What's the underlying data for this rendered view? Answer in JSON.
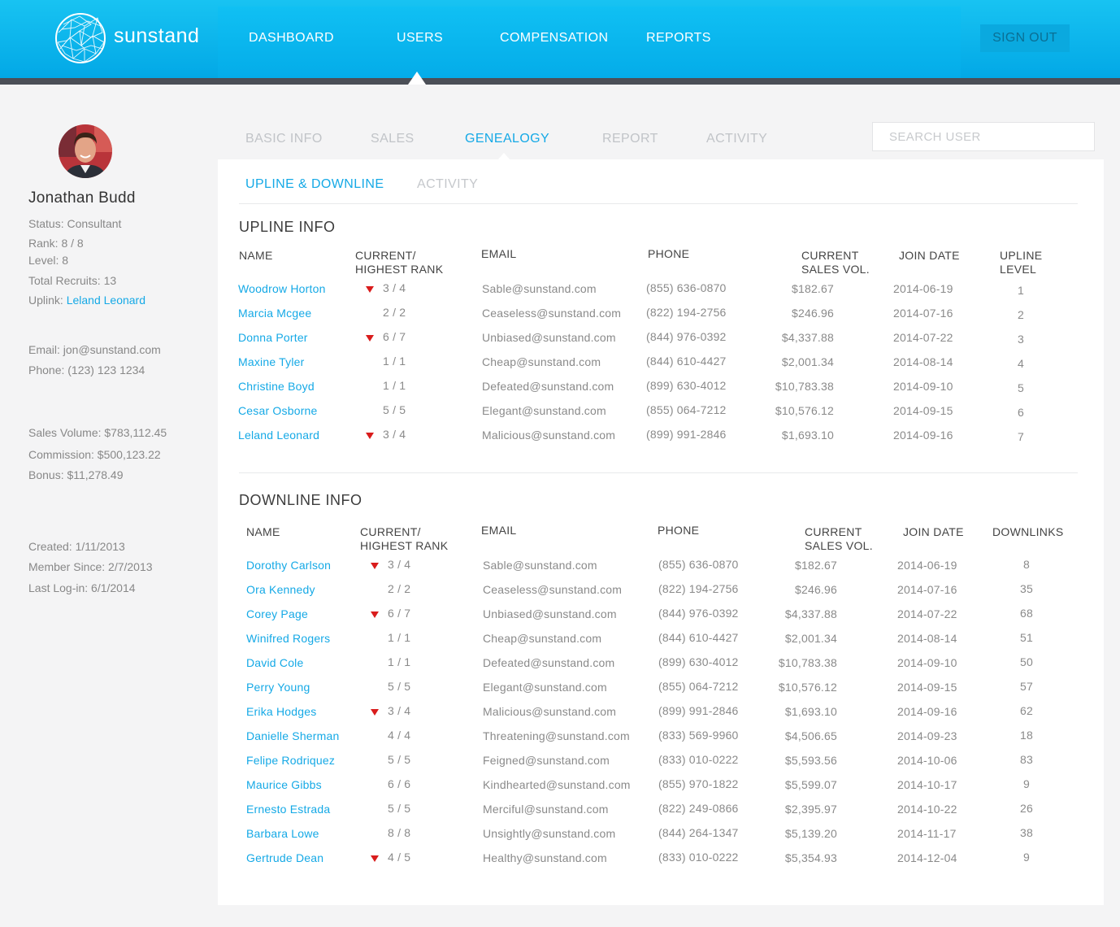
{
  "brand": {
    "name": "sunstand"
  },
  "nav": {
    "items": [
      "DASHBOARD",
      "USERS",
      "COMPENSATION",
      "REPORTS"
    ],
    "active": "USERS",
    "signout": "SIGN OUT"
  },
  "profile": {
    "name": "Jonathan Budd",
    "status_label": "Status: Consultant",
    "rank_label": "Rank: 8 / 8",
    "level_label": "Level: 8",
    "recruits_label": "Total Recruits: 13",
    "uplink_label": "Uplink: ",
    "uplink_name": "Leland Leonard",
    "email_label": "Email: jon@sunstand.com",
    "phone_label": "Phone: (123) 123 1234",
    "sales_label": "Sales Volume: $783,112.45",
    "commission_label": "Commission: $500,123.22",
    "bonus_label": "Bonus: $11,278.49",
    "created_label": "Created: 1/11/2013",
    "member_label": "Member Since: 2/7/2013",
    "login_label": "Last Log-in: 6/1/2014"
  },
  "tabs": {
    "items": [
      "BASIC INFO",
      "SALES",
      "GENEALOGY",
      "REPORT",
      "ACTIVITY"
    ],
    "active": "GENEALOGY"
  },
  "search": {
    "placeholder": "SEARCH USER"
  },
  "subtabs": {
    "items": [
      "UPLINE & DOWNLINE",
      "ACTIVITY"
    ],
    "active": "UPLINE & DOWNLINE"
  },
  "colors": {
    "accent": "#15a9e6",
    "header": "#02a8e6",
    "rank_down": "#d91c1c"
  },
  "upline": {
    "title": "UPLINE INFO",
    "headers": {
      "name": "NAME",
      "rank": [
        "CURRENT/",
        "HIGHEST RANK"
      ],
      "email": "EMAIL",
      "phone": "PHONE",
      "sales": [
        "CURRENT",
        "SALES VOL."
      ],
      "join": "JOIN DATE",
      "last": [
        "UPLINE",
        "LEVEL"
      ]
    },
    "rows": [
      {
        "name": "Woodrow Horton",
        "rank": "3 / 4",
        "down": true,
        "email": "Sable@sunstand.com",
        "phone": "(855) 636-0870",
        "sales": "$182.67",
        "join": "2014-06-19",
        "last": "1"
      },
      {
        "name": "Marcia Mcgee",
        "rank": "2 / 2",
        "down": false,
        "email": "Ceaseless@sunstand.com",
        "phone": "(822) 194-2756",
        "sales": "$246.96",
        "join": "2014-07-16",
        "last": "2"
      },
      {
        "name": "Donna Porter",
        "rank": "6 / 7",
        "down": true,
        "email": "Unbiased@sunstand.com",
        "phone": "(844) 976-0392",
        "sales": "$4,337.88",
        "join": "2014-07-22",
        "last": "3"
      },
      {
        "name": "Maxine Tyler",
        "rank": "1 / 1",
        "down": false,
        "email": "Cheap@sunstand.com",
        "phone": "(844) 610-4427",
        "sales": "$2,001.34",
        "join": "2014-08-14",
        "last": "4"
      },
      {
        "name": "Christine Boyd",
        "rank": "1 / 1",
        "down": false,
        "email": "Defeated@sunstand.com",
        "phone": "(899) 630-4012",
        "sales": "$10,783.38",
        "join": "2014-09-10",
        "last": "5"
      },
      {
        "name": "Cesar Osborne",
        "rank": "5 / 5",
        "down": false,
        "email": "Elegant@sunstand.com",
        "phone": "(855) 064-7212",
        "sales": "$10,576.12",
        "join": "2014-09-15",
        "last": "6"
      },
      {
        "name": "Leland Leonard",
        "rank": "3 / 4",
        "down": true,
        "email": "Malicious@sunstand.com",
        "phone": "(899) 991-2846",
        "sales": "$1,693.10",
        "join": "2014-09-16",
        "last": "7"
      }
    ]
  },
  "downline": {
    "title": "DOWNLINE INFO",
    "headers": {
      "name": "NAME",
      "rank": [
        "CURRENT/",
        "HIGHEST RANK"
      ],
      "email": "EMAIL",
      "phone": "PHONE",
      "sales": [
        "CURRENT",
        "SALES VOL."
      ],
      "join": "JOIN DATE",
      "last": [
        "DOWNLINKS"
      ]
    },
    "rows": [
      {
        "name": "Dorothy Carlson",
        "rank": "3 / 4",
        "down": true,
        "email": "Sable@sunstand.com",
        "phone": "(855) 636-0870",
        "sales": "$182.67",
        "join": "2014-06-19",
        "last": "8"
      },
      {
        "name": "Ora Kennedy",
        "rank": "2 / 2",
        "down": false,
        "email": "Ceaseless@sunstand.com",
        "phone": "(822) 194-2756",
        "sales": "$246.96",
        "join": "2014-07-16",
        "last": "35"
      },
      {
        "name": "Corey Page",
        "rank": "6 / 7",
        "down": true,
        "email": "Unbiased@sunstand.com",
        "phone": "(844) 976-0392",
        "sales": "$4,337.88",
        "join": "2014-07-22",
        "last": "68"
      },
      {
        "name": "Winifred Rogers",
        "rank": "1 / 1",
        "down": false,
        "email": "Cheap@sunstand.com",
        "phone": "(844) 610-4427",
        "sales": "$2,001.34",
        "join": "2014-08-14",
        "last": "51"
      },
      {
        "name": "David Cole",
        "rank": "1 / 1",
        "down": false,
        "email": "Defeated@sunstand.com",
        "phone": "(899) 630-4012",
        "sales": "$10,783.38",
        "join": "2014-09-10",
        "last": "50"
      },
      {
        "name": "Perry Young",
        "rank": "5 / 5",
        "down": false,
        "email": "Elegant@sunstand.com",
        "phone": "(855) 064-7212",
        "sales": "$10,576.12",
        "join": "2014-09-15",
        "last": "57"
      },
      {
        "name": "Erika  Hodges",
        "rank": "3 / 4",
        "down": true,
        "email": "Malicious@sunstand.com",
        "phone": "(899) 991-2846",
        "sales": "$1,693.10",
        "join": "2014-09-16",
        "last": "62"
      },
      {
        "name": "Danielle Sherman",
        "rank": "4 / 4",
        "down": false,
        "email": "Threatening@sunstand.com",
        "phone": "(833) 569-9960",
        "sales": "$4,506.65",
        "join": "2014-09-23",
        "last": "18"
      },
      {
        "name": "Felipe Rodriquez",
        "rank": "5 / 5",
        "down": false,
        "email": "Feigned@sunstand.com",
        "phone": "(833) 010-0222",
        "sales": "$5,593.56",
        "join": "2014-10-06",
        "last": "83"
      },
      {
        "name": "Maurice Gibbs",
        "rank": "6 / 6",
        "down": false,
        "email": "Kindhearted@sunstand.com",
        "phone": "(855) 970-1822",
        "sales": "$5,599.07",
        "join": "2014-10-17",
        "last": "9"
      },
      {
        "name": "Ernesto Estrada",
        "rank": "5 / 5",
        "down": false,
        "email": "Merciful@sunstand.com",
        "phone": "(822) 249-0866",
        "sales": "$2,395.97",
        "join": "2014-10-22",
        "last": "26"
      },
      {
        "name": "Barbara Lowe",
        "rank": "8 / 8",
        "down": false,
        "email": "Unsightly@sunstand.com",
        "phone": "(844) 264-1347",
        "sales": "$5,139.20",
        "join": "2014-11-17",
        "last": "38"
      },
      {
        "name": "Gertrude Dean",
        "rank": "4 / 5",
        "down": true,
        "email": "Healthy@sunstand.com",
        "phone": "(833) 010-0222",
        "sales": "$5,354.93",
        "join": "2014-12-04",
        "last": "9"
      }
    ]
  }
}
